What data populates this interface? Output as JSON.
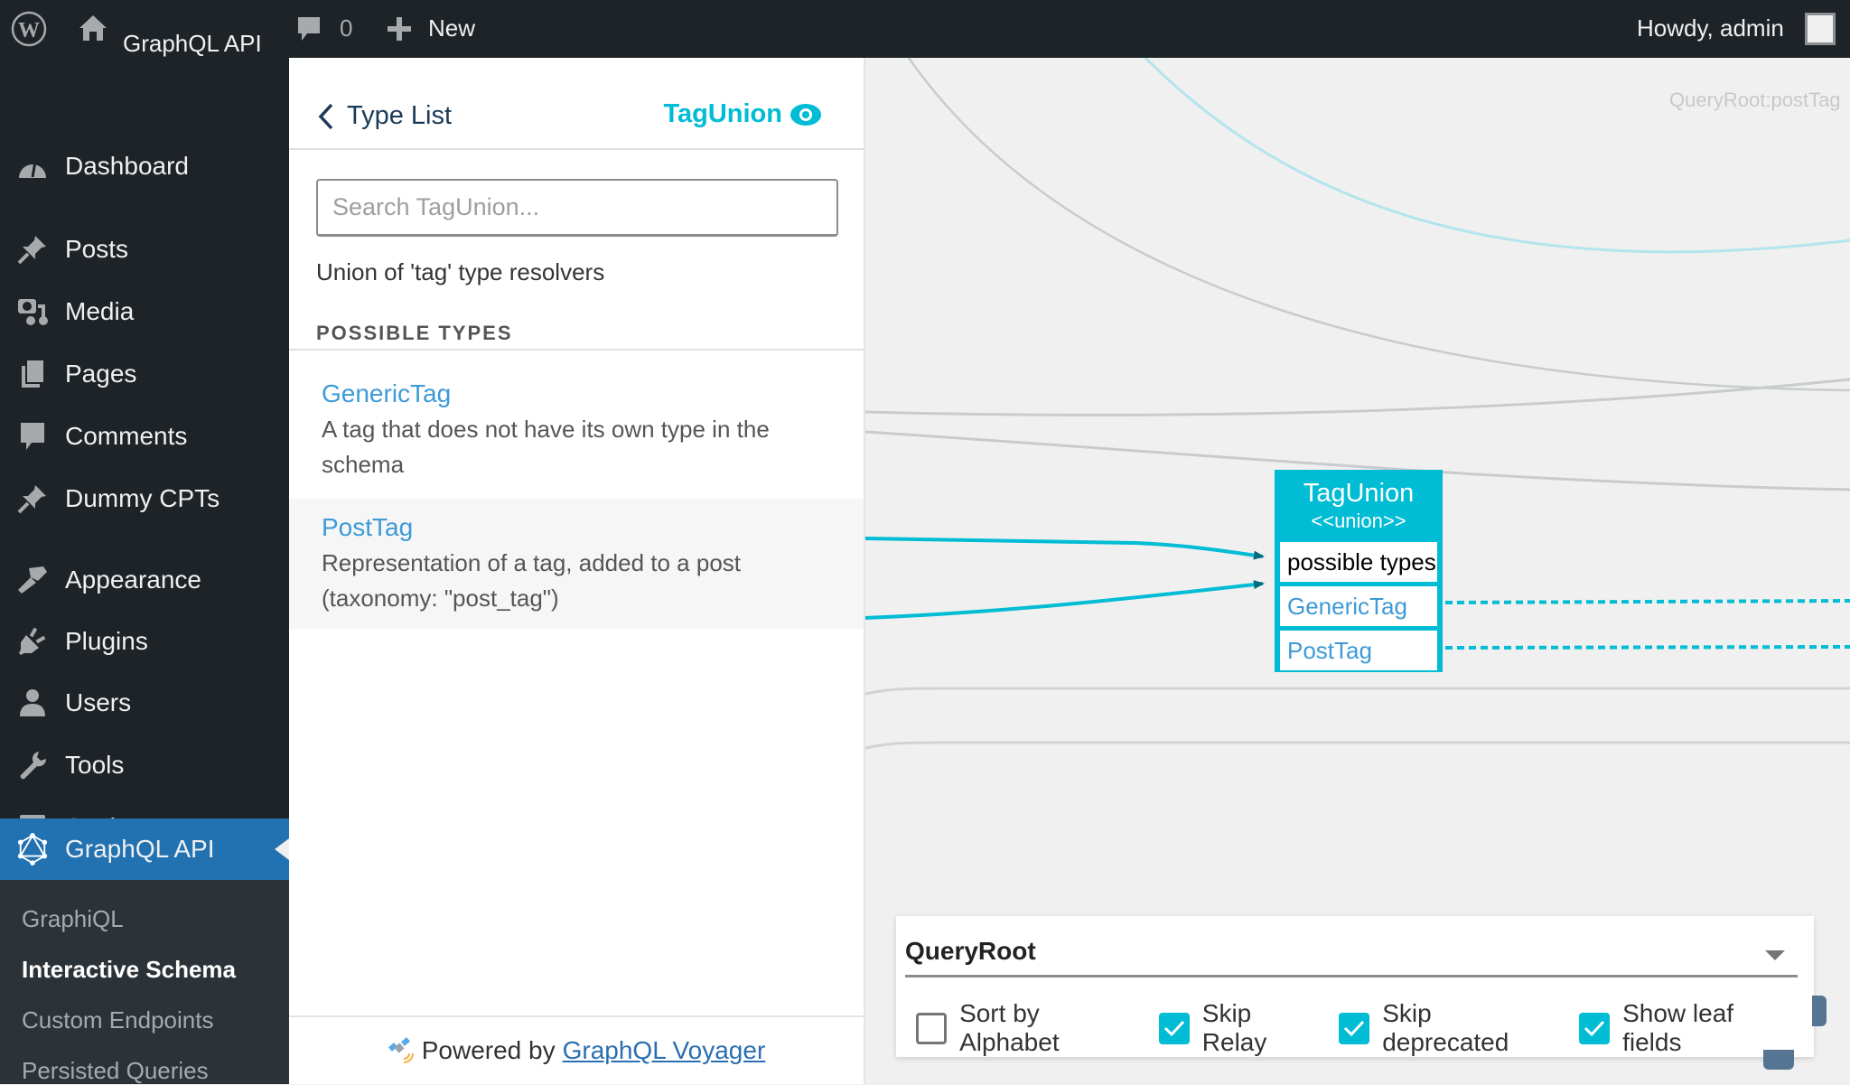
{
  "admin_bar": {
    "site_name": "GraphQL API",
    "comments_count": "0",
    "new_label": "New",
    "howdy": "Howdy, admin"
  },
  "sidebar": {
    "items": [
      {
        "label": "Dashboard",
        "icon": "dashboard-icon"
      },
      {
        "label": "Posts",
        "icon": "pushpin-icon"
      },
      {
        "label": "Media",
        "icon": "media-icon"
      },
      {
        "label": "Pages",
        "icon": "pages-icon"
      },
      {
        "label": "Comments",
        "icon": "comment-icon"
      },
      {
        "label": "Dummy CPTs",
        "icon": "pushpin-icon"
      },
      {
        "label": "Appearance",
        "icon": "paintbrush-icon"
      },
      {
        "label": "Plugins",
        "icon": "plugin-icon"
      },
      {
        "label": "Users",
        "icon": "user-icon"
      },
      {
        "label": "Tools",
        "icon": "wrench-icon"
      },
      {
        "label": "Settings",
        "icon": "settings-icon"
      },
      {
        "label": "GraphQL API",
        "icon": "graphql-icon",
        "active": true
      }
    ],
    "submenu": [
      {
        "label": "GraphiQL"
      },
      {
        "label": "Interactive Schema",
        "current": true
      },
      {
        "label": "Custom Endpoints"
      },
      {
        "label": "Persisted Queries"
      }
    ]
  },
  "type_panel": {
    "back_label": "Type List",
    "type_name": "TagUnion",
    "search_placeholder": "Search TagUnion...",
    "description": "Union of 'tag' type resolvers",
    "section_title": "POSSIBLE TYPES",
    "possible_types": [
      {
        "name": "GenericTag",
        "description": "A tag that does not have its own type in the schema"
      },
      {
        "name": "PostTag",
        "description": "Representation of a tag, added to a post (taxonomy: \"post_tag\")"
      }
    ],
    "footer_prefix": "Powered by",
    "footer_link": "GraphQL Voyager"
  },
  "graph": {
    "edge_label": "QueryRoot:postTag",
    "node": {
      "title": "TagUnion",
      "subtitle": "<<union>>",
      "header_row": "possible types",
      "rows": [
        "GenericTag",
        "PostTag"
      ]
    },
    "colors": {
      "accent": "#00bcd4",
      "arrow": "#006a7a",
      "edge_gray": "#c8cccd",
      "edge_light_cyan": "#b3e5ec"
    }
  },
  "settings": {
    "root_select": "QueryRoot",
    "checkboxes": [
      {
        "label": "Sort by Alphabet",
        "checked": false
      },
      {
        "label": "Skip Relay",
        "checked": true
      },
      {
        "label": "Skip deprecated",
        "checked": true
      },
      {
        "label": "Show leaf fields",
        "checked": true
      }
    ]
  }
}
